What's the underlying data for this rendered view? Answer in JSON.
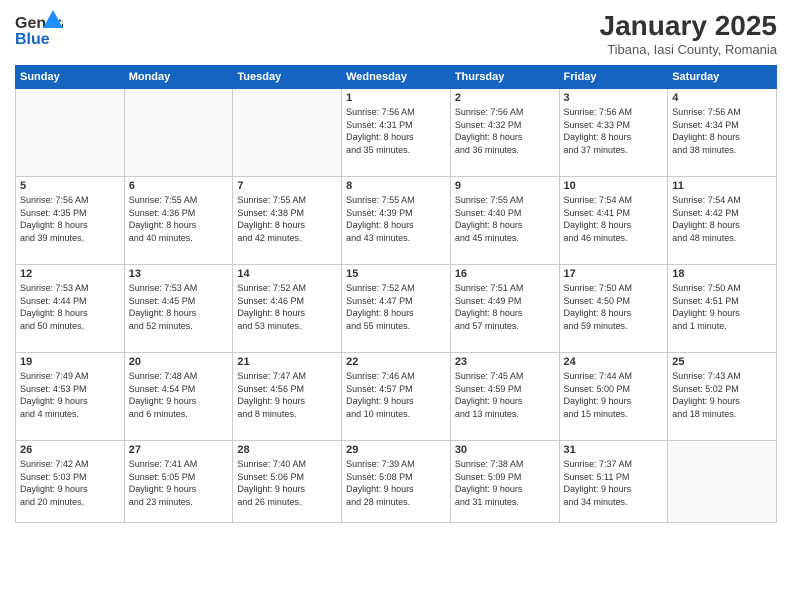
{
  "header": {
    "logo_general": "General",
    "logo_blue": "Blue",
    "month_title": "January 2025",
    "location": "Tibana, Iasi County, Romania"
  },
  "weekdays": [
    "Sunday",
    "Monday",
    "Tuesday",
    "Wednesday",
    "Thursday",
    "Friday",
    "Saturday"
  ],
  "weeks": [
    [
      {
        "day": "",
        "info": ""
      },
      {
        "day": "",
        "info": ""
      },
      {
        "day": "",
        "info": ""
      },
      {
        "day": "1",
        "info": "Sunrise: 7:56 AM\nSunset: 4:31 PM\nDaylight: 8 hours\nand 35 minutes."
      },
      {
        "day": "2",
        "info": "Sunrise: 7:56 AM\nSunset: 4:32 PM\nDaylight: 8 hours\nand 36 minutes."
      },
      {
        "day": "3",
        "info": "Sunrise: 7:56 AM\nSunset: 4:33 PM\nDaylight: 8 hours\nand 37 minutes."
      },
      {
        "day": "4",
        "info": "Sunrise: 7:56 AM\nSunset: 4:34 PM\nDaylight: 8 hours\nand 38 minutes."
      }
    ],
    [
      {
        "day": "5",
        "info": "Sunrise: 7:56 AM\nSunset: 4:35 PM\nDaylight: 8 hours\nand 39 minutes."
      },
      {
        "day": "6",
        "info": "Sunrise: 7:55 AM\nSunset: 4:36 PM\nDaylight: 8 hours\nand 40 minutes."
      },
      {
        "day": "7",
        "info": "Sunrise: 7:55 AM\nSunset: 4:38 PM\nDaylight: 8 hours\nand 42 minutes."
      },
      {
        "day": "8",
        "info": "Sunrise: 7:55 AM\nSunset: 4:39 PM\nDaylight: 8 hours\nand 43 minutes."
      },
      {
        "day": "9",
        "info": "Sunrise: 7:55 AM\nSunset: 4:40 PM\nDaylight: 8 hours\nand 45 minutes."
      },
      {
        "day": "10",
        "info": "Sunrise: 7:54 AM\nSunset: 4:41 PM\nDaylight: 8 hours\nand 46 minutes."
      },
      {
        "day": "11",
        "info": "Sunrise: 7:54 AM\nSunset: 4:42 PM\nDaylight: 8 hours\nand 48 minutes."
      }
    ],
    [
      {
        "day": "12",
        "info": "Sunrise: 7:53 AM\nSunset: 4:44 PM\nDaylight: 8 hours\nand 50 minutes."
      },
      {
        "day": "13",
        "info": "Sunrise: 7:53 AM\nSunset: 4:45 PM\nDaylight: 8 hours\nand 52 minutes."
      },
      {
        "day": "14",
        "info": "Sunrise: 7:52 AM\nSunset: 4:46 PM\nDaylight: 8 hours\nand 53 minutes."
      },
      {
        "day": "15",
        "info": "Sunrise: 7:52 AM\nSunset: 4:47 PM\nDaylight: 8 hours\nand 55 minutes."
      },
      {
        "day": "16",
        "info": "Sunrise: 7:51 AM\nSunset: 4:49 PM\nDaylight: 8 hours\nand 57 minutes."
      },
      {
        "day": "17",
        "info": "Sunrise: 7:50 AM\nSunset: 4:50 PM\nDaylight: 8 hours\nand 59 minutes."
      },
      {
        "day": "18",
        "info": "Sunrise: 7:50 AM\nSunset: 4:51 PM\nDaylight: 9 hours\nand 1 minute."
      }
    ],
    [
      {
        "day": "19",
        "info": "Sunrise: 7:49 AM\nSunset: 4:53 PM\nDaylight: 9 hours\nand 4 minutes."
      },
      {
        "day": "20",
        "info": "Sunrise: 7:48 AM\nSunset: 4:54 PM\nDaylight: 9 hours\nand 6 minutes."
      },
      {
        "day": "21",
        "info": "Sunrise: 7:47 AM\nSunset: 4:56 PM\nDaylight: 9 hours\nand 8 minutes."
      },
      {
        "day": "22",
        "info": "Sunrise: 7:46 AM\nSunset: 4:57 PM\nDaylight: 9 hours\nand 10 minutes."
      },
      {
        "day": "23",
        "info": "Sunrise: 7:45 AM\nSunset: 4:59 PM\nDaylight: 9 hours\nand 13 minutes."
      },
      {
        "day": "24",
        "info": "Sunrise: 7:44 AM\nSunset: 5:00 PM\nDaylight: 9 hours\nand 15 minutes."
      },
      {
        "day": "25",
        "info": "Sunrise: 7:43 AM\nSunset: 5:02 PM\nDaylight: 9 hours\nand 18 minutes."
      }
    ],
    [
      {
        "day": "26",
        "info": "Sunrise: 7:42 AM\nSunset: 5:03 PM\nDaylight: 9 hours\nand 20 minutes."
      },
      {
        "day": "27",
        "info": "Sunrise: 7:41 AM\nSunset: 5:05 PM\nDaylight: 9 hours\nand 23 minutes."
      },
      {
        "day": "28",
        "info": "Sunrise: 7:40 AM\nSunset: 5:06 PM\nDaylight: 9 hours\nand 26 minutes."
      },
      {
        "day": "29",
        "info": "Sunrise: 7:39 AM\nSunset: 5:08 PM\nDaylight: 9 hours\nand 28 minutes."
      },
      {
        "day": "30",
        "info": "Sunrise: 7:38 AM\nSunset: 5:09 PM\nDaylight: 9 hours\nand 31 minutes."
      },
      {
        "day": "31",
        "info": "Sunrise: 7:37 AM\nSunset: 5:11 PM\nDaylight: 9 hours\nand 34 minutes."
      },
      {
        "day": "",
        "info": ""
      }
    ]
  ]
}
